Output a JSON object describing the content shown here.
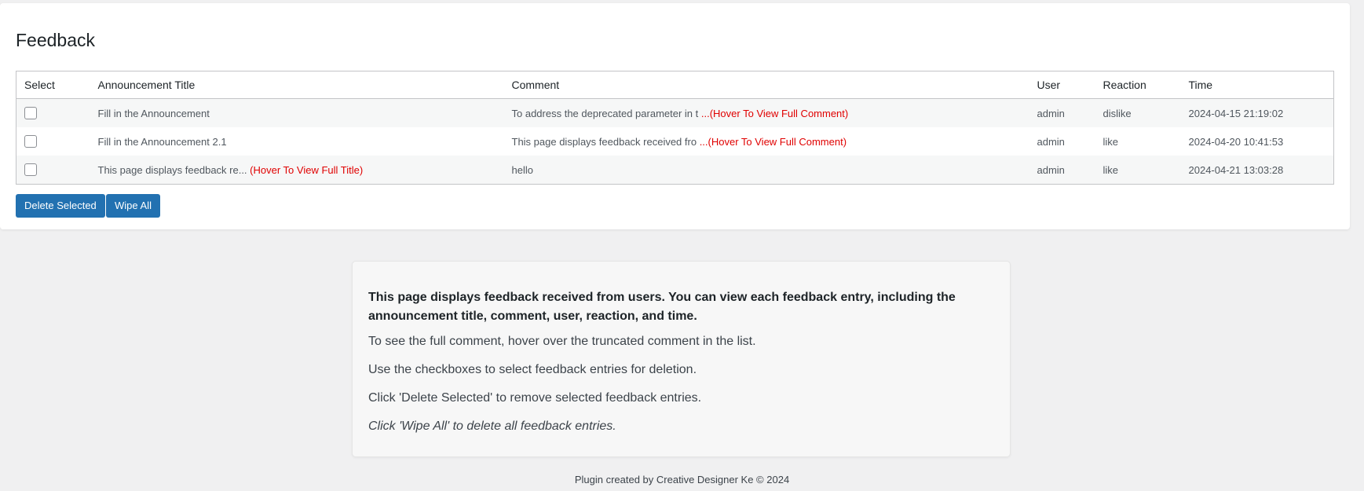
{
  "page": {
    "title": "Feedback"
  },
  "table": {
    "columns": [
      "Select",
      "Announcement Title",
      "Comment",
      "User",
      "Reaction",
      "Time"
    ],
    "rows": [
      {
        "title": "Fill in the Announcement",
        "title_hint": "",
        "comment": "To address the deprecated parameter in t",
        "comment_hint": " ...(Hover To View Full Comment)",
        "user": "admin",
        "reaction": "dislike",
        "time": "2024-04-15 21:19:02"
      },
      {
        "title": "Fill in the Announcement 2.1",
        "title_hint": "",
        "comment": "This page displays feedback received fro",
        "comment_hint": " ...(Hover To View Full Comment)",
        "user": "admin",
        "reaction": "like",
        "time": "2024-04-20 10:41:53"
      },
      {
        "title": "This page displays feedback re...",
        "title_hint": " (Hover To View Full Title)",
        "comment": "hello",
        "comment_hint": "",
        "user": "admin",
        "reaction": "like",
        "time": "2024-04-21 13:03:28"
      }
    ]
  },
  "actions": {
    "delete_selected": "Delete Selected",
    "wipe_all": "Wipe All"
  },
  "info": {
    "lead": "This page displays feedback received from users. You can view each feedback entry, including the announcement title, comment, user, reaction, and time.",
    "line1": "To see the full comment, hover over the truncated comment in the list.",
    "line2": "Use the checkboxes to select feedback entries for deletion.",
    "line3": "Click 'Delete Selected' to remove selected feedback entries.",
    "line4": "Click 'Wipe All' to delete all feedback entries."
  },
  "footer": {
    "text": "Plugin created by Creative Designer Ke © 2024"
  },
  "colors": {
    "accent": "#2271b1",
    "hint": "#e00000"
  }
}
